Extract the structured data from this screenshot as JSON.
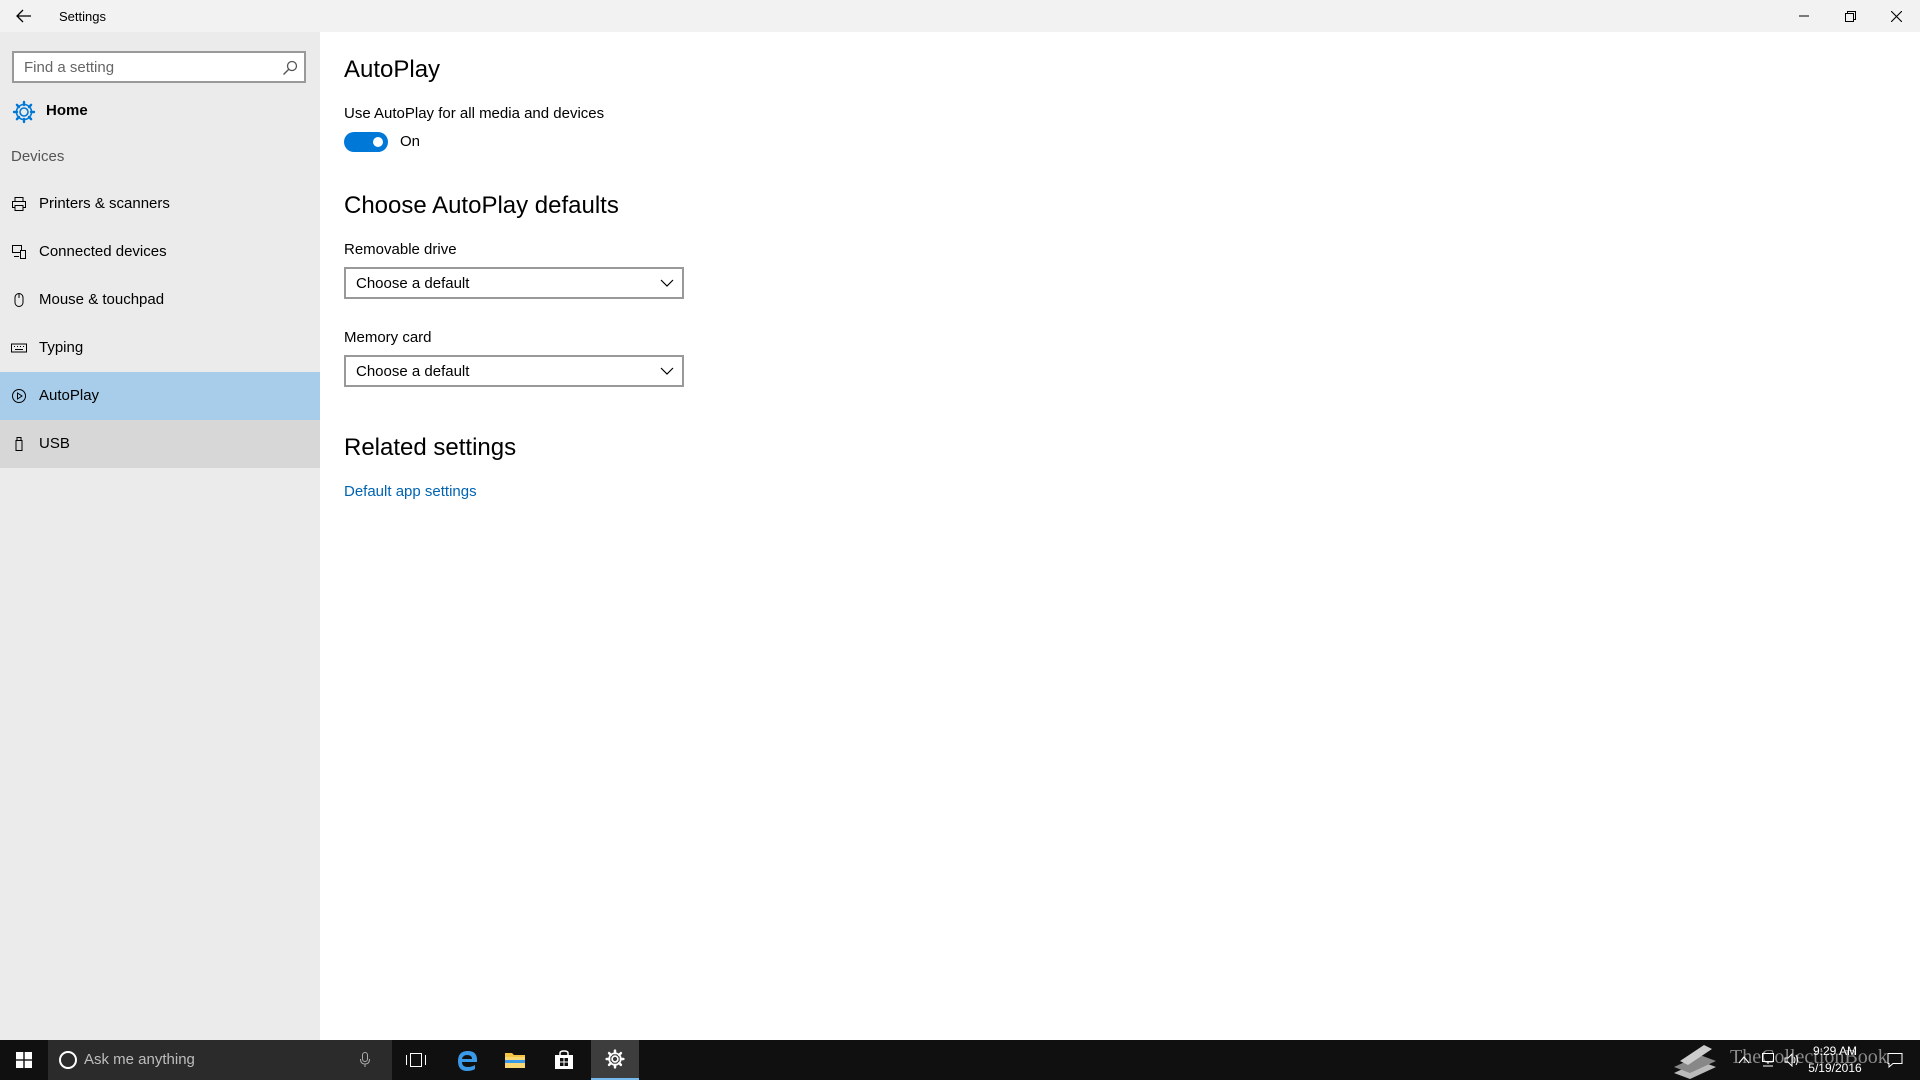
{
  "window": {
    "title": "Settings"
  },
  "sidebar": {
    "search_placeholder": "Find a setting",
    "home_label": "Home",
    "group_label": "Devices",
    "items": [
      {
        "label": "Printers & scanners",
        "icon": "printer-icon"
      },
      {
        "label": "Connected devices",
        "icon": "devices-icon"
      },
      {
        "label": "Mouse & touchpad",
        "icon": "mouse-icon"
      },
      {
        "label": "Typing",
        "icon": "keyboard-icon"
      },
      {
        "label": "AutoPlay",
        "icon": "autoplay-icon",
        "selected": true
      },
      {
        "label": "USB",
        "icon": "usb-icon"
      }
    ]
  },
  "main": {
    "title": "AutoPlay",
    "autoplay_toggle": {
      "label": "Use AutoPlay for all media and devices",
      "state": "On"
    },
    "defaults_heading": "Choose AutoPlay defaults",
    "removable_drive": {
      "label": "Removable drive",
      "value": "Choose a default"
    },
    "memory_card": {
      "label": "Memory card",
      "value": "Choose a default"
    },
    "related_heading": "Related settings",
    "related_link": "Default app settings"
  },
  "taskbar": {
    "cortana_placeholder": "Ask me anything",
    "time": "9:29 AM",
    "date": "5/19/2016",
    "watermark": "TheCollectionBook"
  },
  "colors": {
    "accent": "#0078d7",
    "link": "#0063b1",
    "selected": "#a7cdea",
    "sidebar_bg": "#ebebeb",
    "taskbar_bg": "#101010"
  }
}
